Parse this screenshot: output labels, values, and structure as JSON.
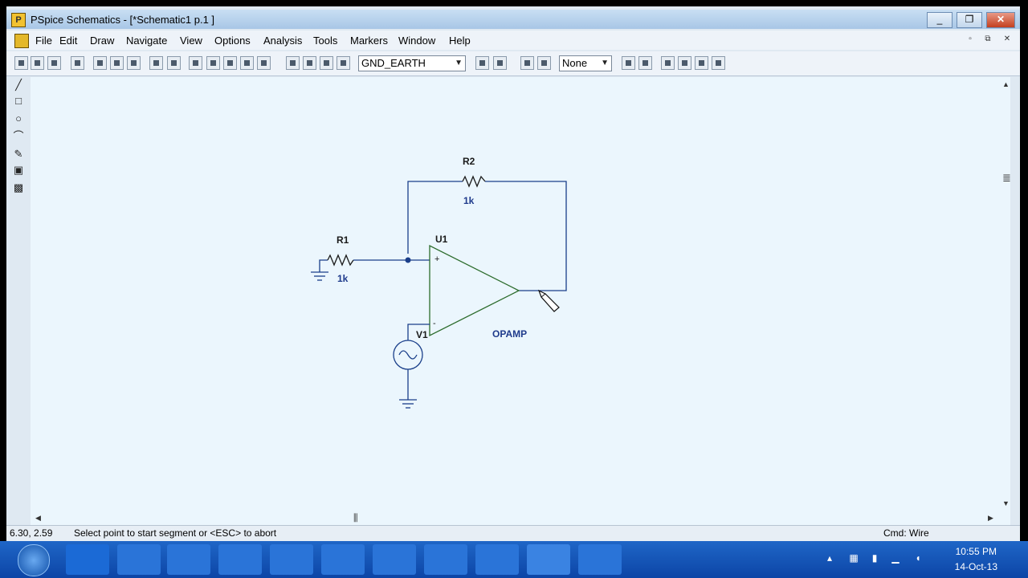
{
  "window": {
    "title": "PSpice Schematics - [*Schematic1  p.1  ]"
  },
  "menu": [
    "File",
    "Edit",
    "Draw",
    "Navigate",
    "View",
    "Options",
    "Analysis",
    "Tools",
    "Markers",
    "Window",
    "Help"
  ],
  "toolbar": {
    "part_combo": "GND_EARTH",
    "display_combo": "None"
  },
  "schematic": {
    "r1": {
      "ref": "R1",
      "value": "1k"
    },
    "r2": {
      "ref": "R2",
      "value": "1k"
    },
    "u1": {
      "ref": "U1",
      "model": "OPAMP"
    },
    "v1": {
      "ref": "V1"
    },
    "pins": {
      "plus": "+",
      "minus": "-"
    }
  },
  "status": {
    "coords": "6.30,  2.59",
    "message": "Select point to start segment or <ESC> to abort",
    "cmd": "Cmd: Wire"
  },
  "taskbar": {
    "time": "10:55 PM",
    "date": "14-Oct-13",
    "apps": [
      "ie-icon",
      "explorer-icon",
      "media-player-icon",
      "firefox-icon",
      "chrome-icon",
      "skype-icon",
      "sync-icon",
      "app-icon",
      "app-icon",
      "pspice-icon",
      "folder-icon"
    ]
  },
  "colors": {
    "wire": "#1a3f8a",
    "opamp": "#2b6b2b",
    "label": "#1a1a1a",
    "value": "#1f3b8c",
    "taskbar": "#1558bd"
  }
}
